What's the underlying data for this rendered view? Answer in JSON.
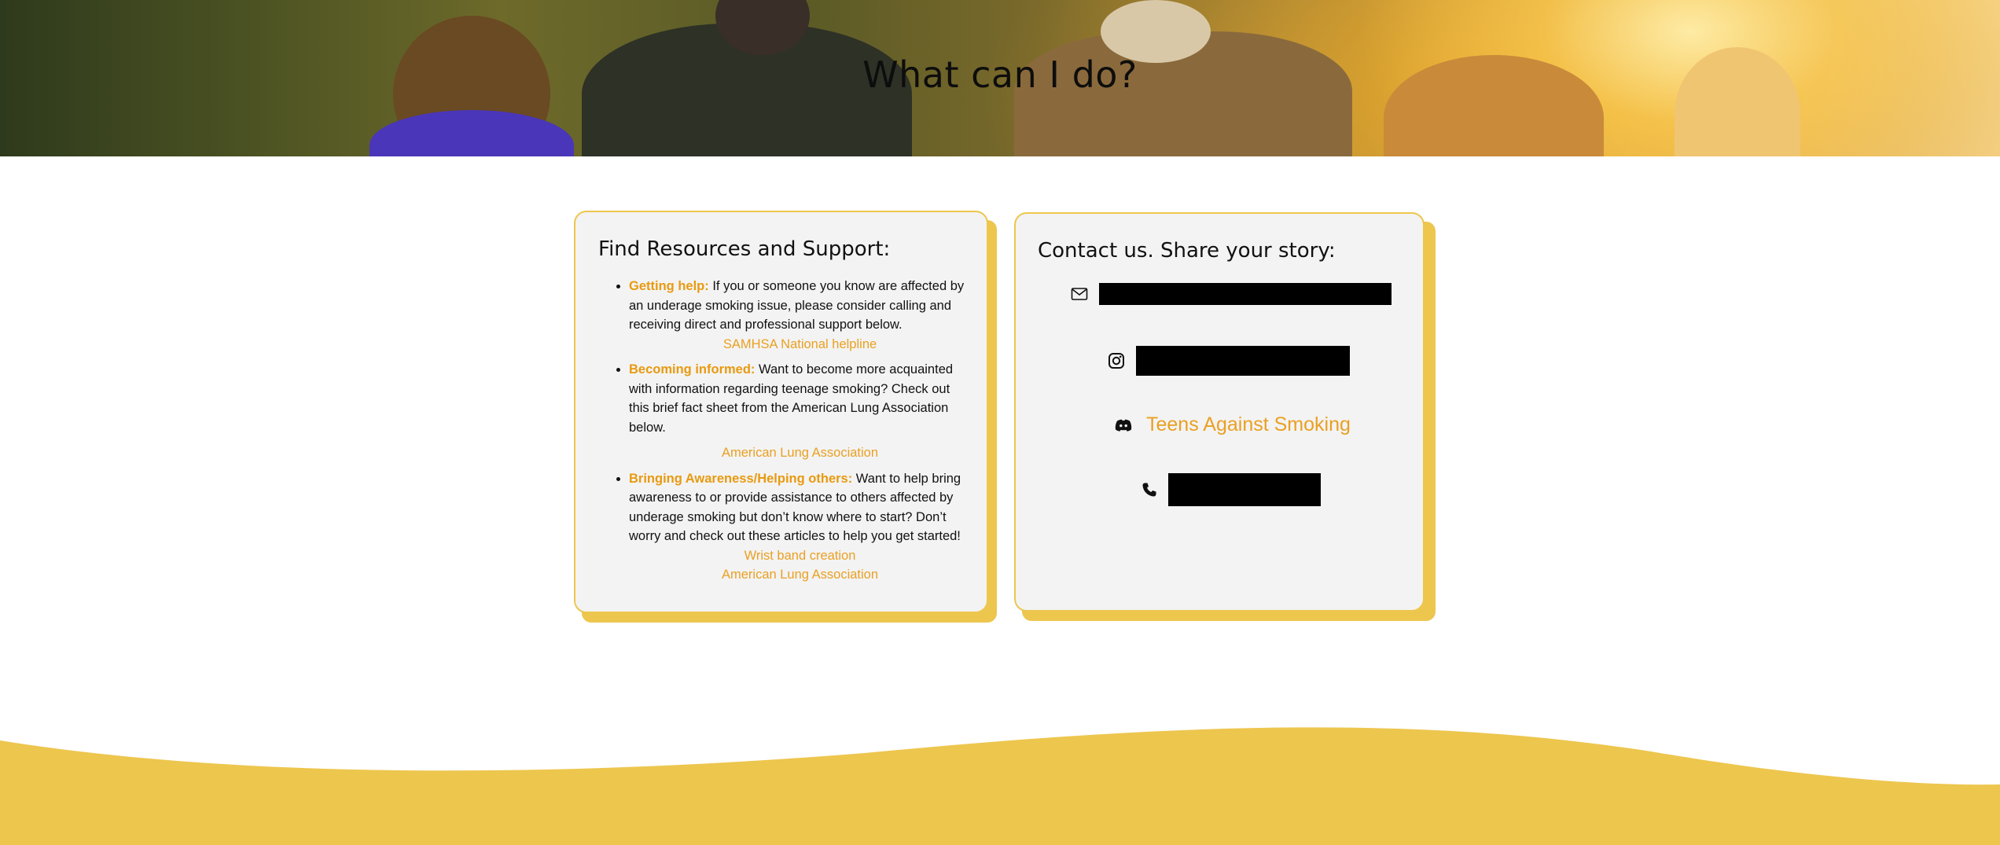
{
  "hero": {
    "title": "What can I do?"
  },
  "resources": {
    "title": "Find Resources and Support:",
    "items": [
      {
        "lead": "Getting help:",
        "text": " If you or someone you know are affected by an underage smoking issue, please consider calling and receiving direct and professional support below.",
        "links": [
          "SAMHSA National helpline"
        ]
      },
      {
        "lead": "Becoming informed:",
        "text": " Want to become more acquainted with information regarding teenage smoking? Check out this brief fact sheet from the American Lung Association below.",
        "links": [
          "American Lung Association"
        ]
      },
      {
        "lead": "Bringing Awareness/Helping others:",
        "text": " Want to help bring awareness to or provide assistance to others affected by underage smoking but don’t know where to start? Don’t worry and check out these articles to help you get started!",
        "links": [
          "Wrist band creation",
          "American Lung Association"
        ]
      }
    ]
  },
  "contact": {
    "title": "Contact us. Share your story:",
    "discord_label": "Teens Against Smoking",
    "icons": {
      "email": "mail-icon",
      "instagram": "instagram-icon",
      "discord": "discord-icon",
      "phone": "phone-icon"
    }
  },
  "colors": {
    "accent": "#edc64e",
    "link": "#eaa022",
    "card_bg": "#f3f3f3"
  }
}
